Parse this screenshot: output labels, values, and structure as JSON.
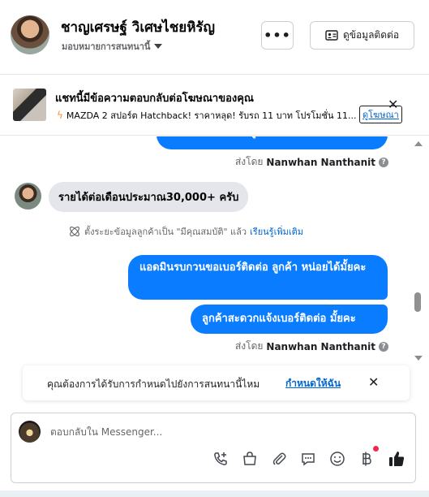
{
  "header": {
    "name": "ชาญเศรษฐ์ วิเศษไชยหิรัญ",
    "assign_label": "มอบหมายการสนทนานี้",
    "more_label": "•••",
    "contact_button_label": "ดูข้อมูลติดต่อ"
  },
  "ad_banner": {
    "title": "แชทนี้มีข้อความตอบกลับต่อโฆษณาของคุณ",
    "subtitle": "MAZDA 2 สปอร์ต Hatchback! ราคาหลุด! รับรถ 11 บาท โปรโมชั่น 11...",
    "view_ad_link": "ดูโฆษณา",
    "close_glyph": "✕"
  },
  "messages": {
    "top_cut_text": "รายได้ต่อเดือนต้อง ลูกค้า กี่บาทต่อเดือนคะ",
    "sent_by_label": "ส่งโดย",
    "sent_by_name": "Nanwhan Nanthanit",
    "incoming_text": "รายได้ต่อเดือนประมาณ30,000+ ครับ",
    "system_text": "ตั้งระยะข้อมูลลูกค้าเป็น \"มีคุณสมบัติ\" แล้ว",
    "system_link": "เรียนรู้เพิ่มเติม",
    "outgoing_1": "แอดมินรบกวนขอเบอร์ติดต่อ ลูกค้า   หน่อยได้มั้ยคะ",
    "outgoing_2": "ลูกค้าสะดวกแจ้งเบอร์ติดต่อ มั้ยคะ"
  },
  "suggestion": {
    "text": "คุณต้องการได้รับการกำหนดไปยังการสนทนานี้ไหม",
    "link": "กำหนดให้ฉัน",
    "close_glyph": "✕"
  },
  "composer": {
    "placeholder": "ตอบกลับใน Messenger..."
  },
  "colors": {
    "accent": "#0a7cff",
    "link": "#0064d1",
    "incoming_bubble": "#e4e6eb",
    "notification_dot": "#f02849"
  }
}
